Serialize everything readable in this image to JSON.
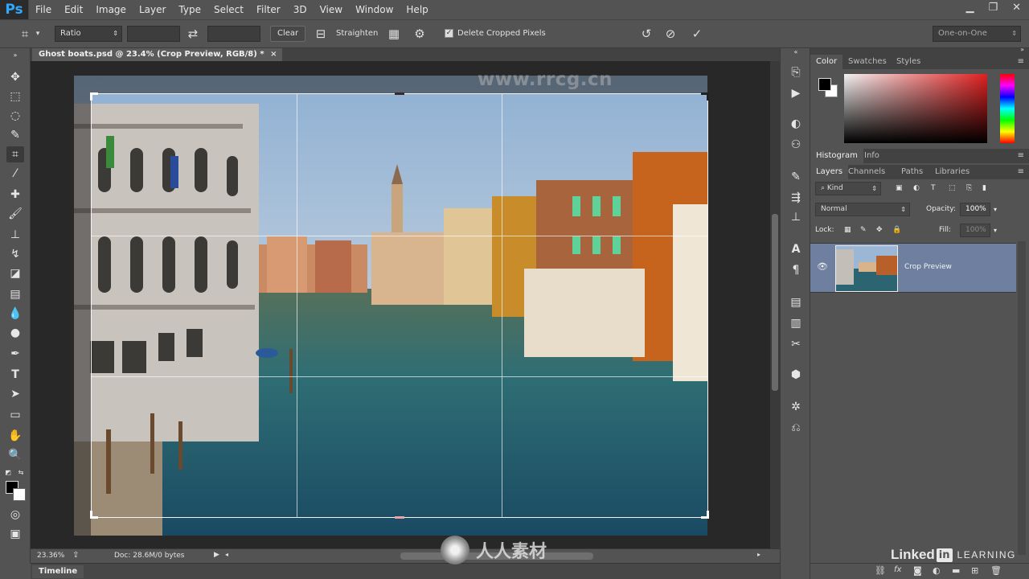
{
  "app": {
    "logo": "Ps",
    "menu": [
      "File",
      "Edit",
      "Image",
      "Layer",
      "Type",
      "Select",
      "Filter",
      "3D",
      "View",
      "Window",
      "Help"
    ],
    "window_controls": [
      "minimize-icon",
      "restore-icon",
      "close-icon"
    ]
  },
  "options_bar": {
    "ratio_select": "Ratio",
    "width_field": "",
    "height_field": "",
    "clear_label": "Clear",
    "straighten_label": "Straighten",
    "delete_cropped_label": "Delete Cropped Pixels",
    "delete_cropped_checked": true,
    "workspace_select": "One-on-One"
  },
  "document": {
    "tab_title": "Ghost boats.psd @ 23.4% (Crop Preview, RGB/8) *",
    "close_glyph": "×"
  },
  "status": {
    "zoom": "23.36%",
    "doc_size": "Doc: 28.6M/0 bytes"
  },
  "timeline": {
    "label": "Timeline"
  },
  "panels": {
    "color_tabs": [
      "Color",
      "Swatches",
      "Styles"
    ],
    "histogram_tabs": [
      "Histogram",
      "Info"
    ],
    "layers_tabs": [
      "Layers",
      "Channels",
      "Paths",
      "Libraries"
    ],
    "kind_filter": "Kind",
    "blend_mode": "Normal",
    "opacity_label": "Opacity:",
    "opacity_value": "100%",
    "lock_label": "Lock:",
    "fill_label": "Fill:",
    "fill_value": "100%",
    "layer_name": "Crop Preview"
  },
  "watermarks": {
    "top": "www.rrcg.cn",
    "bottom": "人人素材",
    "linkedin": "Linked",
    "linkedin_badge": "in",
    "learning": "LEARNING"
  }
}
